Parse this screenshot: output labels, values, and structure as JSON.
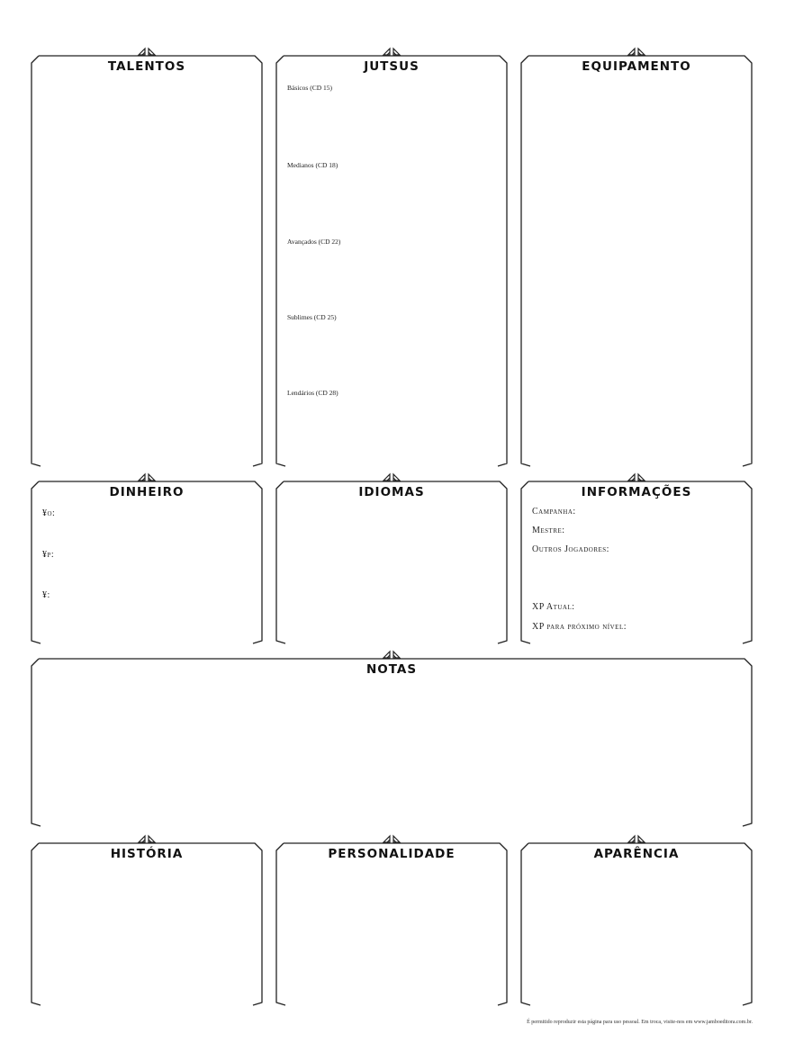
{
  "boxes": {
    "talentos": {
      "title": "TALENTOS"
    },
    "jutsus": {
      "title": "JUTSUS",
      "levels": [
        "Básicos (CD 15)",
        "Medianos (CD 18)",
        "Avançados (CD 22)",
        "Sublimes (CD 25)",
        "Lendários (CD 28)"
      ]
    },
    "equipamento": {
      "title": "EQUIPAMENTO"
    },
    "dinheiro": {
      "title": "DINHEIRO",
      "lines": [
        "¥o:",
        "¥p:",
        "¥:"
      ]
    },
    "idiomas": {
      "title": "IDIOMAS"
    },
    "informacoes": {
      "title": "INFORMAÇÕES",
      "lines": [
        "Campanha:",
        "Mestre:",
        "Outros Jogadores:",
        "XP Atual:",
        "XP para próximo nível:"
      ]
    },
    "notas": {
      "title": "NOTAS"
    },
    "historia": {
      "title": "HISTÓRIA"
    },
    "personalidade": {
      "title": "PERSONALIDADE"
    },
    "aparencia": {
      "title": "APARÊNCIA"
    }
  },
  "footer": "É permitido reproduzir esta página para uso pessoal. Em troca, visite-nos em www.jamboeditora.com.br.",
  "colors": {
    "stroke": "#222222"
  }
}
